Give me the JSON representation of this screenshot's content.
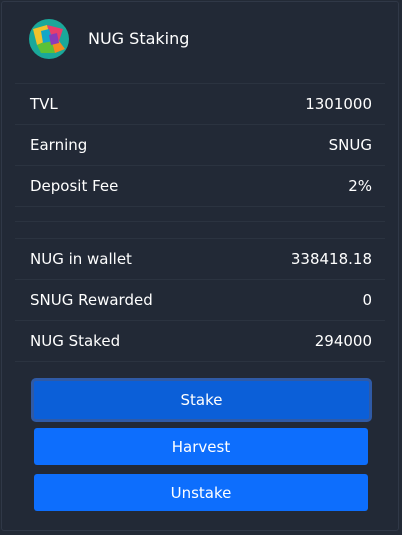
{
  "header": {
    "title": "NUG Staking",
    "logo_icon": "nug-logo-icon"
  },
  "pool_info": [
    {
      "label": "TVL",
      "value": "1301000"
    },
    {
      "label": "Earning",
      "value": "SNUG"
    },
    {
      "label": "Deposit Fee",
      "value": "2%"
    }
  ],
  "user_info": [
    {
      "label": "NUG in wallet",
      "value": "338418.18"
    },
    {
      "label": "SNUG Rewarded",
      "value": "0"
    },
    {
      "label": "NUG Staked",
      "value": "294000"
    }
  ],
  "actions": {
    "stake_label": "Stake",
    "harvest_label": "Harvest",
    "unstake_label": "Unstake"
  },
  "colors": {
    "background": "#222936",
    "button": "#0d6efd",
    "button_focused": "#0b5fd8"
  }
}
